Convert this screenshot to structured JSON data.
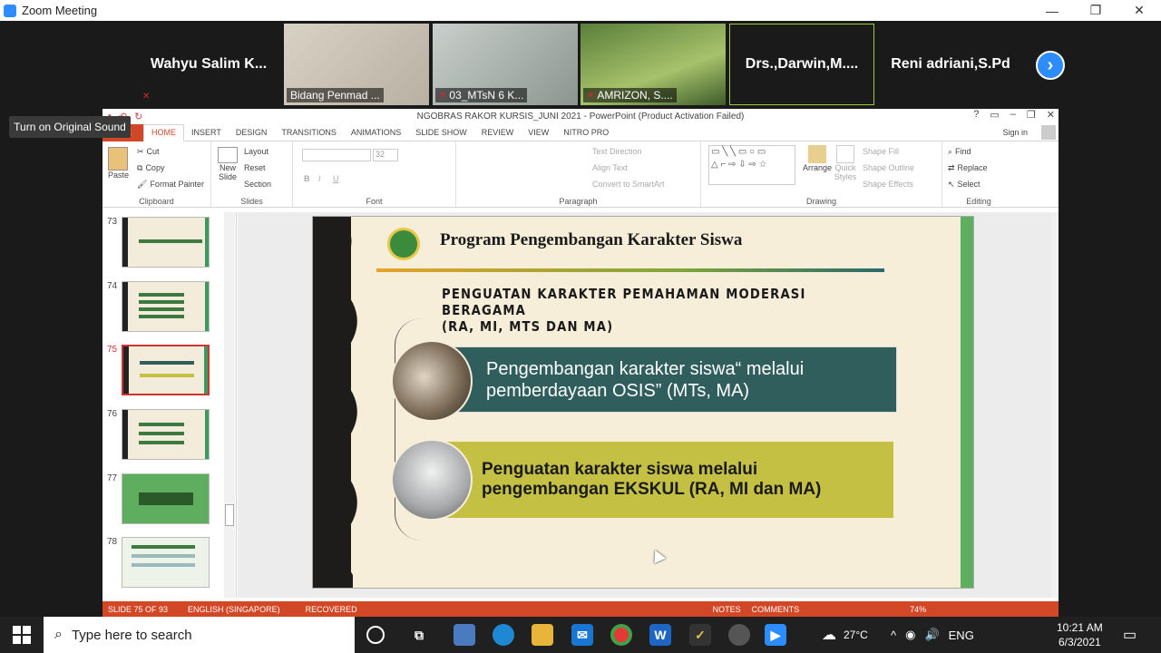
{
  "zoom": {
    "title": "Zoom Meeting",
    "window_controls": [
      "—",
      "❐",
      "✕"
    ],
    "participants": [
      {
        "name": "Wahyu Salim K...",
        "video": false,
        "muted": true
      },
      {
        "name": "Bidang Penmad ...",
        "video": true,
        "muted": false
      },
      {
        "name": "03_MTsN 6 K...",
        "video": true,
        "muted": true
      },
      {
        "name": "AMRIZON, S....",
        "video": true,
        "muted": true
      },
      {
        "name": "Drs.,Darwin,M....",
        "video": false,
        "active": true
      },
      {
        "name": "Reni adriani,S.Pd",
        "video": false
      }
    ],
    "next_button": "›",
    "tooltip": "Turn on Original Sound"
  },
  "ppt": {
    "title": "NGOBRAS RAKOR KURSIS_JUNI 2021 - PowerPoint (Product Activation Failed)",
    "tabs": [
      "FILE",
      "HOME",
      "INSERT",
      "DESIGN",
      "TRANSITIONS",
      "ANIMATIONS",
      "SLIDE SHOW",
      "REVIEW",
      "VIEW",
      "NITRO PRO"
    ],
    "sign_in": "Sign in",
    "ribbon": {
      "clipboard": {
        "label": "Clipboard",
        "paste": "Paste",
        "cut": "Cut",
        "copy": "Copy",
        "format_painter": "Format Painter"
      },
      "slides": {
        "label": "Slides",
        "new_slide": "New Slide",
        "layout": "Layout",
        "reset": "Reset",
        "section": "Section"
      },
      "font": {
        "label": "Font",
        "size": "32"
      },
      "paragraph": {
        "label": "Paragraph",
        "text_direction": "Text Direction",
        "align_text": "Align Text",
        "convert": "Convert to SmartArt"
      },
      "drawing": {
        "label": "Drawing",
        "arrange": "Arrange",
        "quick_styles": "Quick Styles",
        "shape_fill": "Shape Fill",
        "shape_outline": "Shape Outline",
        "shape_effects": "Shape Effects"
      },
      "editing": {
        "label": "Editing",
        "find": "Find",
        "replace": "Replace",
        "select": "Select"
      }
    },
    "thumbnails": [
      "73",
      "74",
      "75",
      "76",
      "77",
      "78"
    ],
    "selected_slide": "75",
    "slide": {
      "heading": "Program Pengembangan Karakter Siswa",
      "subtitle_1": "PENGUATAN KARAKTER PEMAHAMAN MODERASI",
      "subtitle_2": "BERAGAMA",
      "subtitle_3": "(RA, MI, MTS DAN MA)",
      "box1_line1": "Pengembangan karakter siswa“ melalui",
      "box1_line2": "pemberdayaan OSIS” (MTs, MA)",
      "box2_line1": "Penguatan karakter siswa melalui",
      "box2_line2": "pengembangan EKSKUL (RA, MI dan MA)"
    },
    "status": {
      "slide": "SLIDE 75 OF 93",
      "language": "ENGLISH (SINGAPORE)",
      "recovered": "RECOVERED",
      "notes": "NOTES",
      "comments": "COMMENTS",
      "zoom": "74%"
    }
  },
  "taskbar": {
    "search_placeholder": "Type here to search",
    "weather": "27°C",
    "lang": "ENG",
    "time": "10:21 AM",
    "date": "6/3/2021"
  },
  "colors": {
    "ppt_accent": "#d24726",
    "zoom_blue": "#2d8cff",
    "slide_teal": "#2f5e5c",
    "slide_olive": "#c4c043"
  }
}
